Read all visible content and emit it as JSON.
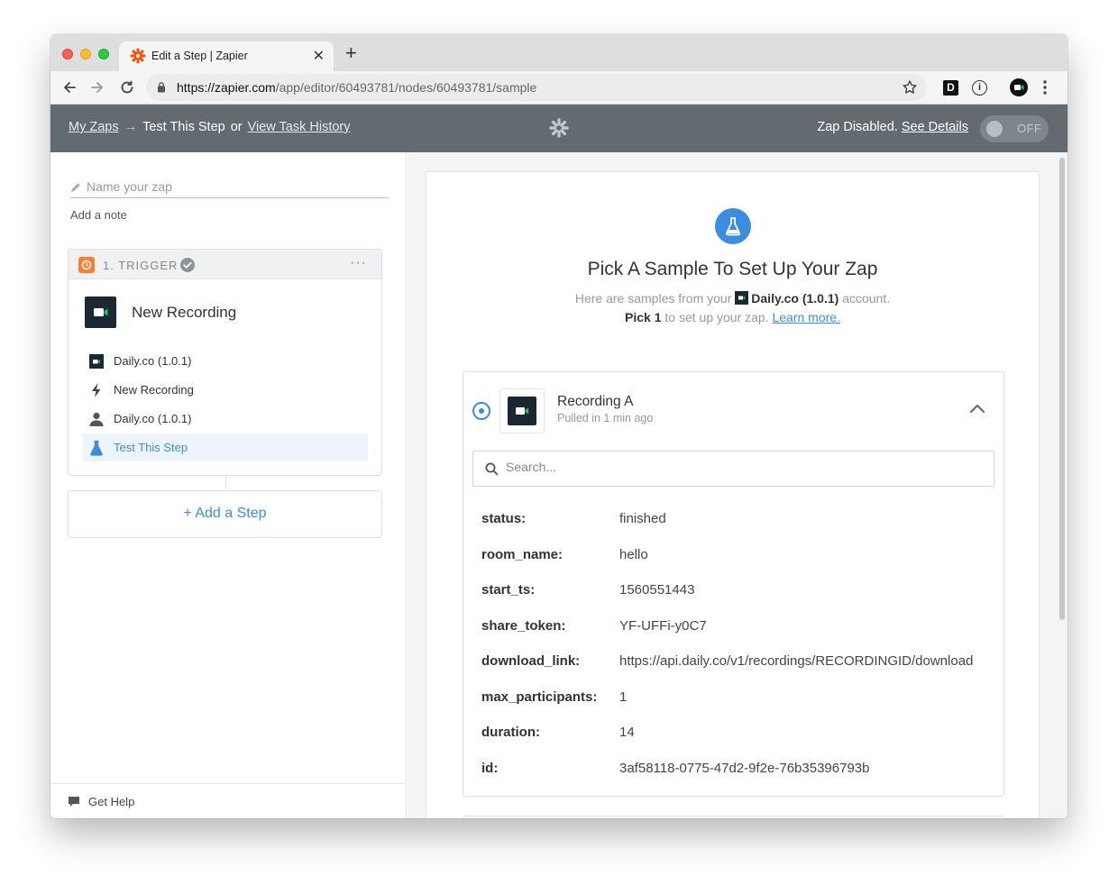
{
  "browser": {
    "tab_title": "Edit a Step | Zapier",
    "url_host": "https://zapier.com",
    "url_path": "/app/editor/60493781/nodes/60493781/sample",
    "extension_d_label": "D",
    "extension_i_label": "i"
  },
  "header": {
    "my_zaps": "My Zaps",
    "arrow": "→",
    "current_step": "Test This Step",
    "or_text": "or",
    "task_history": "View Task History",
    "status_text": "Zap Disabled.",
    "see_details": "See Details",
    "toggle_label": "OFF"
  },
  "sidebar": {
    "name_placeholder": "Name your zap",
    "add_note": "Add a note",
    "trigger": {
      "label": "1. TRIGGER",
      "more": "···",
      "title": "New Recording",
      "items": [
        {
          "label": "Daily.co (1.0.1)"
        },
        {
          "label": "New Recording"
        },
        {
          "label": "Daily.co (1.0.1)"
        },
        {
          "label": "Test This Step"
        }
      ]
    },
    "add_step": "+ Add a Step",
    "get_help": "Get Help"
  },
  "main": {
    "title": "Pick A Sample To Set Up Your Zap",
    "subtitle_prefix": "Here are samples from your",
    "account_name": "Daily.co (1.0.1)",
    "subtitle_suffix": "account.",
    "pick_strong": "Pick 1",
    "pick_rest": "to set up your zap.",
    "learn_more": "Learn more.",
    "sample": {
      "title": "Recording A",
      "subtitle": "Pulled in 1 min ago",
      "search_placeholder": "Search...",
      "fields": [
        {
          "key": "status:",
          "value": "finished"
        },
        {
          "key": "room_name:",
          "value": "hello"
        },
        {
          "key": "start_ts:",
          "value": "1560551443"
        },
        {
          "key": "share_token:",
          "value": "YF-UFFi-y0C7"
        },
        {
          "key": "download_link:",
          "value": "https://api.daily.co/v1/recordings/RECORDINGID/download"
        },
        {
          "key": "max_participants:",
          "value": "1"
        },
        {
          "key": "duration:",
          "value": "14"
        },
        {
          "key": "id:",
          "value": "3af58118-0775-47d2-9f2e-76b35396793b"
        }
      ]
    }
  },
  "colors": {
    "header_bg": "#636b71",
    "accent_blue": "#3b8de0",
    "zapier_orange": "#ff4a00",
    "daily_dark": "#1b2733",
    "daily_green": "#1bc26b"
  }
}
